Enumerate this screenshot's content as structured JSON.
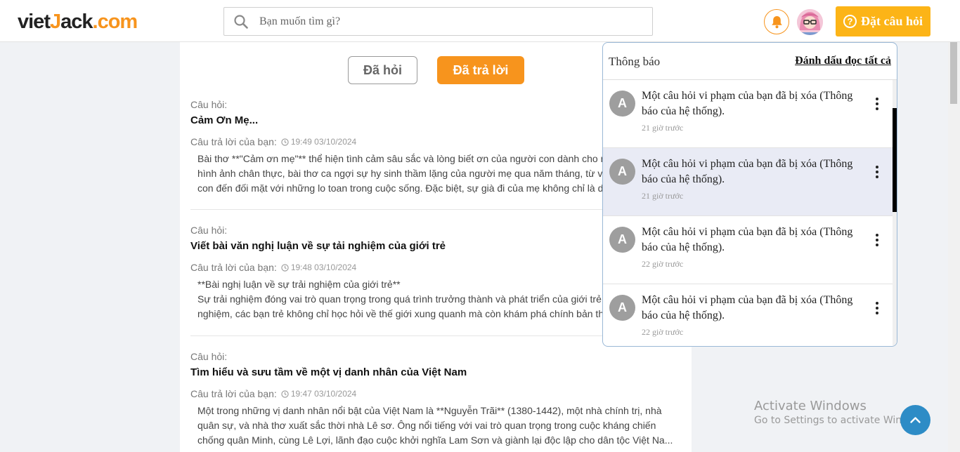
{
  "header": {
    "logo": {
      "part1": "viet",
      "part2": "J",
      "part3": "ack",
      "part4": ".com"
    },
    "search_placeholder": "Bạn muốn tìm gì?",
    "ask_button": "Đặt câu hỏi"
  },
  "tabs": [
    {
      "label": "Đã hỏi"
    },
    {
      "label": "Đã trả lời"
    }
  ],
  "items": [
    {
      "q_label": "Câu hỏi:",
      "title": "Cảm Ơn Mẹ...",
      "a_label": "Câu trả lời của bạn:",
      "time": "19:49 03/10/2024",
      "text": "Bài thơ **\"Cảm ơn mẹ\"** thể hiện tình cảm sâu sắc và lòng biết ơn của người con dành cho m\nhình ảnh chân thực, bài thơ ca ngợi sự hy sinh thầm lặng của người mẹ qua năm tháng, từ v\ncon đến đối mặt với những lo toan trong cuộc sống. Đặc biệt, sự già đi của mẹ không chỉ là d"
    },
    {
      "q_label": "Câu hỏi:",
      "title": "Viết bài văn nghị luận về sự tải nghiệm của giới trẻ",
      "a_label": "Câu trả lời của bạn:",
      "time": "19:48 03/10/2024",
      "text": "**Bài nghị luận về sự trải nghiệm của giới trẻ**\nSự trải nghiệm đóng vai trò quan trọng trong quá trình trưởng thành và phát triển của giới trẻ.\nnghiệm, các bạn trẻ không chỉ học hỏi về thế giới xung quanh mà còn khám phá chính bản th"
    },
    {
      "q_label": "Câu hỏi:",
      "title": "Tìm hiểu và sưu tầm về một vị danh nhân của Việt Nam",
      "a_label": "Câu trả lời của bạn:",
      "time": "19:47 03/10/2024",
      "text": "Một trong những vị danh nhân nổi bật của Việt Nam là **Nguyễn Trãi** (1380-1442), một nhà chính trị, nhà\nquân sự, và nhà thơ xuất sắc thời nhà Lê sơ. Ông nổi tiếng với vai trò quan trọng trong cuộc kháng chiến\nchống quân Minh, cùng Lê Lợi, lãnh đạo cuộc khởi nghĩa Lam Sơn và giành lại độc lập cho dân tộc Việt Na..."
    }
  ],
  "notifications": {
    "title": "Thông báo",
    "mark_all": "Đánh dấu đọc tất cả",
    "items": [
      {
        "avatar": "A",
        "text": "Một câu hỏi vi phạm của bạn đã bị xóa (Thông báo của hệ thống).",
        "time": "21 giờ trước"
      },
      {
        "avatar": "A",
        "text": "Một câu hỏi vi phạm của bạn đã bị xóa (Thông báo của hệ thống).",
        "time": "21 giờ trước"
      },
      {
        "avatar": "A",
        "text": "Một câu hỏi vi phạm của bạn đã bị xóa (Thông báo của hệ thống).",
        "time": "22 giờ trước"
      },
      {
        "avatar": "A",
        "text": "Một câu hỏi vi phạm của bạn đã bị xóa (Thông báo của hệ thống).",
        "time": "22 giờ trước"
      }
    ]
  },
  "watermark": {
    "line1": "Activate Windows",
    "line2": "Go to Settings to activate Windows."
  },
  "colors": {
    "brand_orange": "#f7941d",
    "ask_yellow": "#fcb417",
    "totop_blue": "#2d8cc6"
  }
}
